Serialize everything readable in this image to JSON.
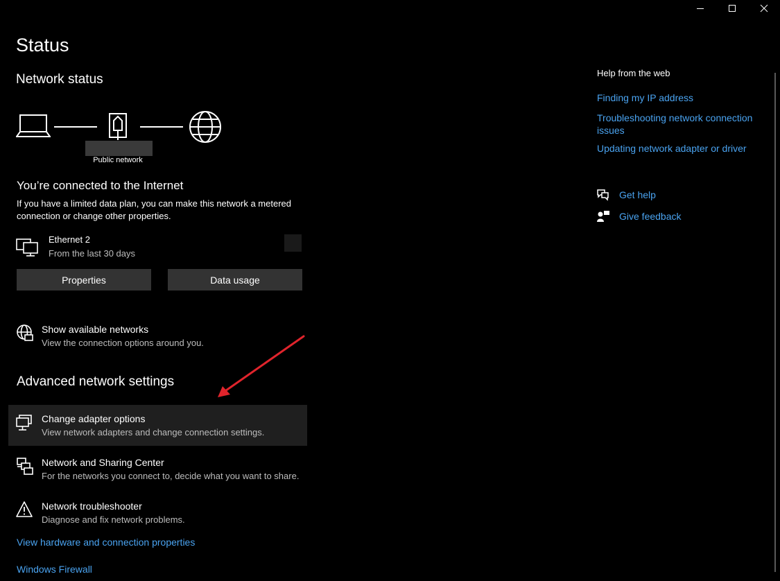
{
  "window": {
    "controls": [
      "minimize-icon",
      "maximize-icon",
      "close-icon"
    ]
  },
  "page": {
    "title": "Status"
  },
  "network_status": {
    "heading": "Network status",
    "network_label": "Public network",
    "connected_heading": "You’re connected to the Internet",
    "connected_desc": "If you have a limited data plan, you can make this network a metered connection or change other properties.",
    "adapter_name": "Ethernet 2",
    "adapter_sub": "From the last 30 days",
    "properties_label": "Properties",
    "data_usage_label": "Data usage"
  },
  "show_networks": {
    "title": "Show available networks",
    "sub": "View the connection options around you."
  },
  "advanced": {
    "heading": "Advanced network settings",
    "items": [
      {
        "title": "Change adapter options",
        "sub": "View network adapters and change connection settings.",
        "icon": "adapter-icon"
      },
      {
        "title": "Network and Sharing Center",
        "sub": "For the networks you connect to, decide what you want to share.",
        "icon": "sharing-center-icon"
      },
      {
        "title": "Network troubleshooter",
        "sub": "Diagnose and fix network problems.",
        "icon": "warning-icon"
      }
    ],
    "links": [
      "View hardware and connection properties",
      "Windows Firewall"
    ]
  },
  "help": {
    "heading": "Help from the web",
    "links": [
      "Finding my IP address",
      "Troubleshooting network connection issues",
      "Updating network adapter or driver"
    ],
    "get_help": "Get help",
    "give_feedback": "Give feedback"
  },
  "colors": {
    "link": "#4aa3f0",
    "annotation_arrow": "#e0242c",
    "button_bg": "#333333",
    "highlight_row": "#1f1f1f"
  }
}
